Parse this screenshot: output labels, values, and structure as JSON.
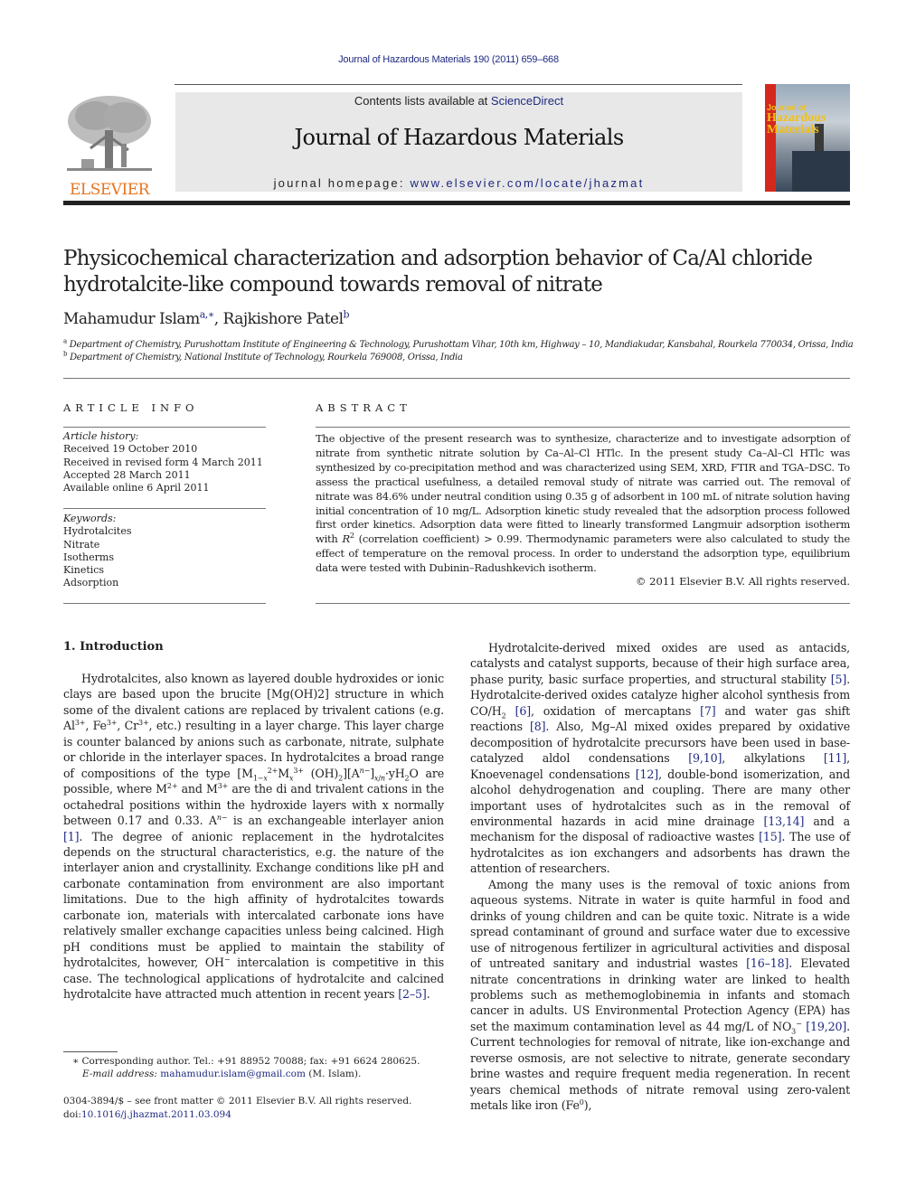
{
  "header": {
    "running_head": "Journal of Hazardous Materials 190 (2011) 659–668",
    "contents_prefix": "Contents lists available at ",
    "contents_link": "ScienceDirect",
    "journal_title": "Journal of Hazardous Materials",
    "homepage_prefix": "journal homepage: ",
    "homepage_link": "www.elsevier.com/locate/jhazmat",
    "publisher_logo_text": "ELSEVIER",
    "cover": {
      "line1": "Journal of",
      "line2": "Hazardous",
      "line3": "Materials"
    },
    "colors": {
      "link": "#1f2a80",
      "elsevier_orange": "#e8731a",
      "banner_bg": "#e8e8e8",
      "cover_red": "#d4281e"
    }
  },
  "article": {
    "title": "Physicochemical characterization and adsorption behavior of Ca/Al chloride hydrotalcite-like compound towards removal of nitrate",
    "authors": [
      {
        "name": "Mahamudur Islam",
        "marks": "a,∗"
      },
      {
        "name": "Rajkishore Patel",
        "marks": "b"
      }
    ],
    "affiliations": [
      {
        "mark": "a",
        "text": "Department of Chemistry, Purushottam Institute of Engineering & Technology, Purushottam Vihar, 10th km, Highway – 10, Mandiakudar, Kansbahal, Rourkela 770034, Orissa, India"
      },
      {
        "mark": "b",
        "text": "Department of Chemistry, National Institute of Technology, Rourkela 769008, Orissa, India"
      }
    ]
  },
  "article_info": {
    "heading": "ARTICLE INFO",
    "history_label": "Article history:",
    "history": [
      "Received 19 October 2010",
      "Received in revised form 4 March 2011",
      "Accepted 28 March 2011",
      "Available online 6 April 2011"
    ],
    "keywords_label": "Keywords:",
    "keywords": [
      "Hydrotalcites",
      "Nitrate",
      "Isotherms",
      "Kinetics",
      "Adsorption"
    ]
  },
  "abstract": {
    "heading": "ABSTRACT",
    "text_1": "The objective of the present research was to synthesize, characterize and to investigate adsorption of nitrate from synthetic nitrate solution by Ca–Al–Cl HTlc. In the present study Ca–Al–Cl HTlc was synthesized by co-precipitation method and was characterized using SEM, XRD, FTIR and TGA–DSC. To assess the practical usefulness, a detailed removal study of nitrate was carried out. The removal of nitrate was 84.6% under neutral condition using 0.35 g of adsorbent in 100 mL of nitrate solution having initial concentration of 10 mg/L. Adsorption kinetic study revealed that the adsorption process followed first order kinetics. Adsorption data were fitted to linearly transformed Langmuir adsorption isotherm with ",
    "r2": "R",
    "text_2": " (correlation coefficient) > 0.99. Thermodynamic parameters were also calculated to study the effect of temperature on the removal process. In order to understand the adsorption type, equilibrium data were tested with Dubinin–Radushkevich isotherm.",
    "copyright": "© 2011 Elsevier B.V. All rights reserved."
  },
  "introduction": {
    "heading": "1.  Introduction",
    "left_p1_a": "Hydrotalcites, also known as layered double hydroxides or ionic clays are based upon the brucite [Mg(OH)2] structure in which some of the divalent cations are replaced by trivalent cations (e.g. Al",
    "left_p1_b": ", Fe",
    "left_p1_c": ", Cr",
    "left_p1_d": ", etc.) resulting in a layer charge. This layer charge is counter balanced by anions such as carbonate, nitrate, sulphate or chloride in the interlayer spaces. In hydrotalcites a broad range of compositions of the type [M",
    "left_p1_e": "M",
    "left_p1_f": " (OH)",
    "left_p1_g": "][A",
    "left_p1_h": "]",
    "left_p1_i": "·yH",
    "left_p1_j": "O are possible, where M",
    "left_p1_k": " and M",
    "left_p1_l": " are the di and trivalent cations in the octahedral positions within the hydroxide layers with x normally between 0.17 and 0.33. A",
    "left_p1_m": " is an exchangeable interlayer anion ",
    "ref_1": "[1]",
    "left_p1_n": ". The degree of anionic replacement in the hydrotalcites depends on the structural characteristics, e.g. the nature of the interlayer anion and crystallinity. Exchange conditions like pH and carbonate contamination from environment are also important limitations. Due to the high affinity of hydrotalcites towards carbonate ion, materials with intercalated carbonate ions have relatively smaller exchange capacities unless being calcined. High pH conditions must be applied to maintain the stability of hydrotalcites, however, OH",
    "left_p1_o": " intercalation is competitive in this case. The technological applications of hydrotalcite and calcined hydrotalcite have attracted much attention in recent years ",
    "ref_2_5": "[2–5]",
    "right_p1_a": "Hydrotalcite-derived mixed oxides are used as antacids, catalysts and catalyst supports, because of their high surface area, phase purity, basic surface properties, and structural stability ",
    "ref_5": "[5]",
    "right_p1_b": ". Hydrotalcite-derived oxides catalyze higher alcohol synthesis from CO/H",
    "ref_6": "[6]",
    "right_p1_c": ", oxidation of mercaptans ",
    "ref_7": "[7]",
    "right_p1_d": " and water gas shift reactions ",
    "ref_8": "[8]",
    "right_p1_e": ". Also, Mg–Al mixed oxides prepared by oxidative decomposition of hydrotalcite precursors have been used in base-catalyzed aldol condensations ",
    "ref_9_10": "[9,10]",
    "right_p1_f": ", alkylations ",
    "ref_11": "[11]",
    "right_p1_g": ", Knoevenagel condensations ",
    "ref_12": "[12]",
    "right_p1_h": ", double-bond isomerization, and alcohol dehydrogenation and coupling. There are many other important uses of hydrotalcites such as in the removal of environmental hazards in acid mine drainage ",
    "ref_13_14": "[13,14]",
    "right_p1_i": " and a mechanism for the disposal of radioactive wastes ",
    "ref_15": "[15]",
    "right_p1_j": ". The use of hydrotalcites as ion exchangers and adsorbents has drawn the attention of researchers.",
    "right_p2_a": "Among the many uses is the removal of toxic anions from aqueous systems. Nitrate in water is quite harmful in food and drinks of young children and can be quite toxic. Nitrate is a wide spread contaminant of ground and surface water due to excessive use of nitrogenous fertilizer in agricultural activities and disposal of untreated sanitary and industrial wastes ",
    "ref_16_18": "[16–18]",
    "right_p2_b": ". Elevated nitrate concentrations in drinking water are linked to health problems such as methemoglobinemia in infants and stomach cancer in adults. US Environmental Protection Agency (EPA) has set the maximum contamination level as 44 mg/L of NO",
    "ref_19_20": "[19,20]",
    "right_p2_c": ". Current technologies for removal of nitrate, like ion-exchange and reverse osmosis, are not selective to nitrate, generate secondary brine wastes and require frequent media regeneration. In recent years chemical methods of nitrate removal using zero-valent metals like iron (Fe",
    "right_p2_d": "),"
  },
  "footnotes": {
    "corresponding": "∗ Corresponding author. Tel.: +91 88952 70088; fax: +91 6624 280625.",
    "email_label": "E-mail address: ",
    "email": "mahamudur.islam@gmail.com",
    "email_suffix": " (M. Islam).",
    "issn": "0304-3894/$ – see front matter © 2011 Elsevier B.V. All rights reserved.",
    "doi_label": "doi:",
    "doi": "10.1016/j.jhazmat.2011.03.094"
  }
}
